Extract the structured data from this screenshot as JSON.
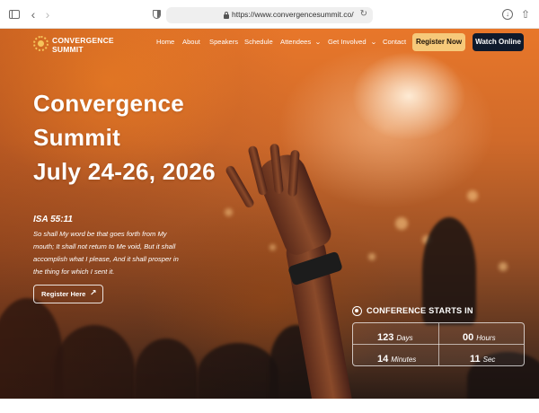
{
  "browser": {
    "url": "https://www.convergencesummit.co/",
    "back_glyph": "‹",
    "forward_glyph": "›",
    "reload_glyph": "↻",
    "download_glyph": "↓",
    "share_glyph": "⇧",
    "icons": [
      "sidebar-toggle-icon",
      "back-icon",
      "forward-icon",
      "privacy-shield-icon",
      "lock-icon",
      "reload-icon",
      "download-icon",
      "share-icon"
    ]
  },
  "logo": {
    "line1": "CONVERGENCE",
    "line2": "SUMMIT",
    "color": "#f6c35a"
  },
  "nav": {
    "items": [
      {
        "label": "Home"
      },
      {
        "label": "About"
      },
      {
        "label": "Speakers"
      },
      {
        "label": "Schedule"
      },
      {
        "label": "Attendees"
      },
      {
        "label": "Get Involved"
      },
      {
        "label": "Contact"
      }
    ],
    "chevron": "⌄",
    "register_label": "Register Now",
    "watch_label": "Watch Online",
    "register_color": "#f6c97a",
    "watch_color": "#0f1a2c"
  },
  "hero": {
    "title_line1": "Convergence",
    "title_line2": "Summit",
    "date_line": "July 24-26, 2026",
    "verse_ref": "ISA 55:11",
    "verse_lines": [
      "So shall My word be that goes forth from My",
      "mouth; It shall not return to Me void, But it shall",
      "accomplish what I please, And it shall prosper in",
      "the thing for which I sent it."
    ],
    "cta_label": "Register Here",
    "cta_arrow": "↗"
  },
  "countdown": {
    "title": "CONFERENCE STARTS IN",
    "cells": [
      {
        "value": "123",
        "unit": "Days"
      },
      {
        "value": "00",
        "unit": "Hours"
      },
      {
        "value": "14",
        "unit": "Minutes"
      },
      {
        "value": "11",
        "unit": "Sec"
      }
    ]
  }
}
